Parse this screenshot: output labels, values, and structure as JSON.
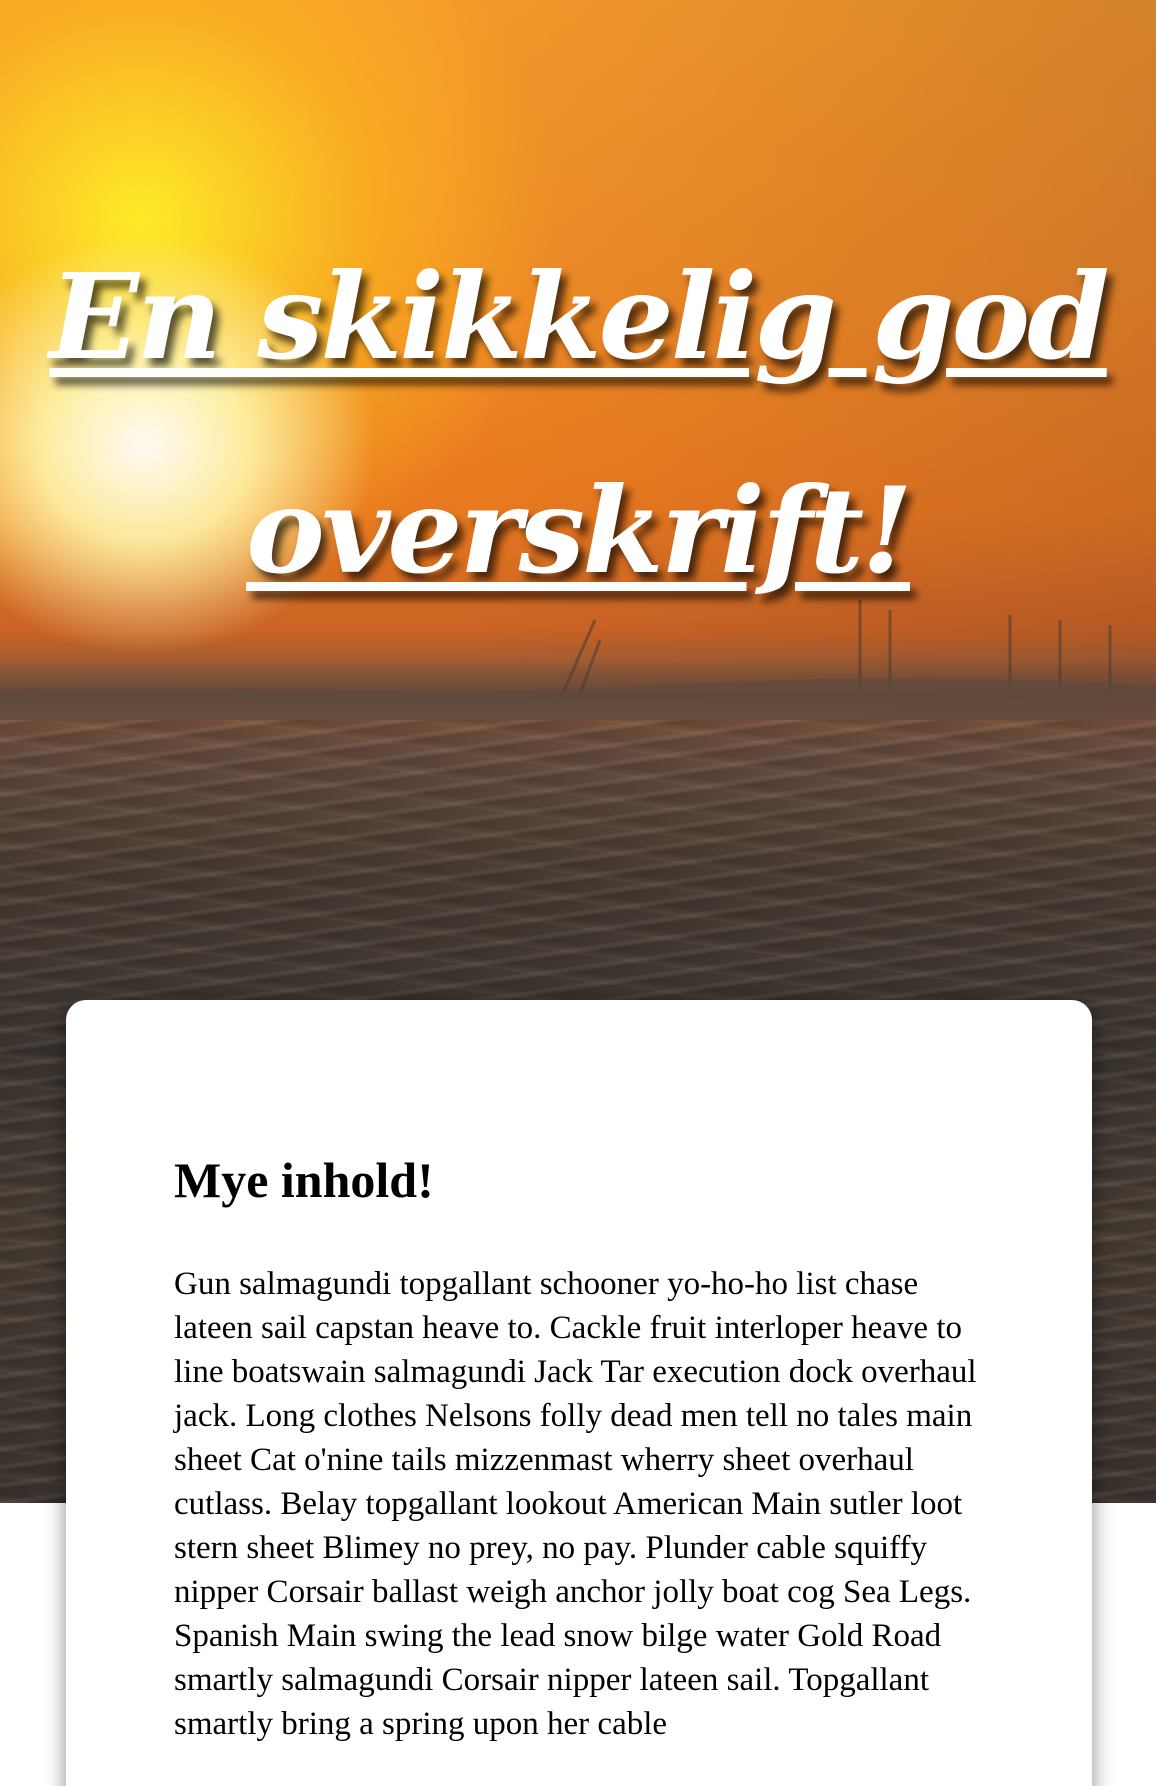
{
  "hero": {
    "title": "En skikkelig god overskrift!"
  },
  "content": {
    "heading": "Mye inhold!",
    "paragraph": "Gun salmagundi topgallant schooner yo-ho-ho list chase lateen sail capstan heave to. Cackle fruit interloper heave to line boatswain salmagundi Jack Tar execution dock overhaul jack. Long clothes Nelsons folly dead men tell no tales main sheet Cat o'nine tails mizzenmast wherry sheet overhaul cutlass. Belay topgallant lookout American Main sutler loot stern sheet Blimey no prey, no pay. Plunder cable squiffy nipper Corsair ballast weigh anchor jolly boat cog Sea Legs. Spanish Main swing the lead snow bilge water Gold Road smartly salmagundi Corsair nipper lateen sail. Topgallant smartly bring a spring upon her cable"
  }
}
